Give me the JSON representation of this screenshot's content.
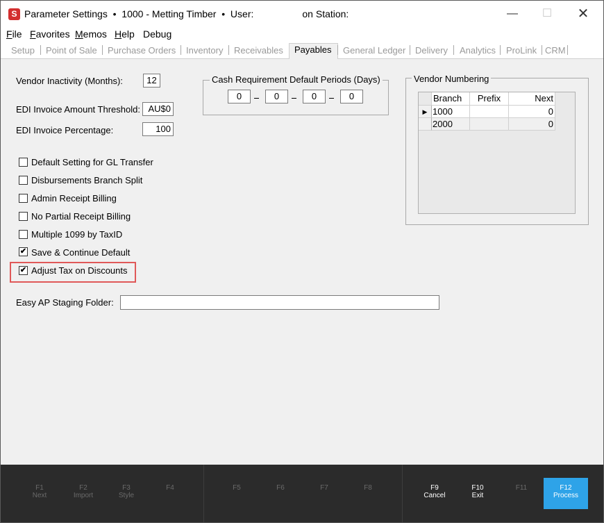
{
  "window": {
    "app_icon": "S",
    "title": "Parameter Settings  •  1000 - Metting Timber  •  User:                  on Station:",
    "min_glyph": "—",
    "max_glyph": "☐",
    "close_glyph": "✕"
  },
  "menubar": {
    "items": [
      {
        "label": "File",
        "underline": "F",
        "rest": "ile"
      },
      {
        "label": "Favorites",
        "pre": "",
        "underline": "F",
        "rest": "avorites"
      },
      {
        "label": "Memos",
        "underline": "M",
        "rest": "emos"
      },
      {
        "label": "Help",
        "underline": "H",
        "rest": "elp"
      },
      {
        "label": "Debug",
        "underline": "",
        "rest": "Debug"
      }
    ]
  },
  "tabs": [
    "Setup",
    "Point of Sale",
    "Purchase Orders",
    "Inventory",
    "Receivables",
    "Payables",
    "General Ledger",
    "Delivery",
    "Analytics",
    "ProLink",
    "CRM"
  ],
  "active_tab": "Payables",
  "fields": {
    "vendor_inactivity_label": "Vendor Inactivity (Months):",
    "vendor_inactivity_value": "12",
    "edi_threshold_label": "EDI Invoice Amount Threshold:",
    "edi_threshold_value": "AU$0",
    "edi_percentage_label": "EDI Invoice Percentage:",
    "edi_percentage_value": "100",
    "easy_ap_label": "Easy AP Staging Folder:",
    "easy_ap_value": ""
  },
  "cash_requirement": {
    "label": "Cash Requirement Default Periods (Days)",
    "periods": [
      "0",
      "0",
      "0",
      "0"
    ]
  },
  "checkboxes": [
    {
      "label": "Default Setting for GL Transfer",
      "checked": false
    },
    {
      "label": "Disbursements Branch Split",
      "checked": false
    },
    {
      "label": "Admin Receipt Billing",
      "checked": false
    },
    {
      "label": "No Partial Receipt Billing",
      "checked": false
    },
    {
      "label": "Multiple 1099 by TaxID",
      "checked": false
    },
    {
      "label": "Save & Continue Default",
      "checked": true
    },
    {
      "label": "Adjust Tax on Discounts",
      "checked": true
    }
  ],
  "check_glyph": "✔",
  "vendor_numbering": {
    "label": "Vendor Numbering",
    "columns": [
      "Branch",
      "Prefix",
      "Next"
    ],
    "rows": [
      {
        "branch": "1000",
        "prefix": "",
        "next": "0"
      },
      {
        "branch": "2000",
        "prefix": "",
        "next": "0"
      }
    ],
    "row_pointer": "▶"
  },
  "footer": {
    "keys": [
      {
        "key": "F1",
        "action": "Next"
      },
      {
        "key": "F2",
        "action": "Import"
      },
      {
        "key": "F3",
        "action": "Style"
      },
      {
        "key": "F4",
        "action": ""
      },
      {
        "key": "F5",
        "action": ""
      },
      {
        "key": "F6",
        "action": ""
      },
      {
        "key": "F7",
        "action": ""
      },
      {
        "key": "F8",
        "action": ""
      },
      {
        "key": "F9",
        "action": "Cancel"
      },
      {
        "key": "F10",
        "action": "Exit"
      },
      {
        "key": "F11",
        "action": ""
      },
      {
        "key": "F12",
        "action": "Process"
      }
    ],
    "accent": "#2ea3e8"
  }
}
